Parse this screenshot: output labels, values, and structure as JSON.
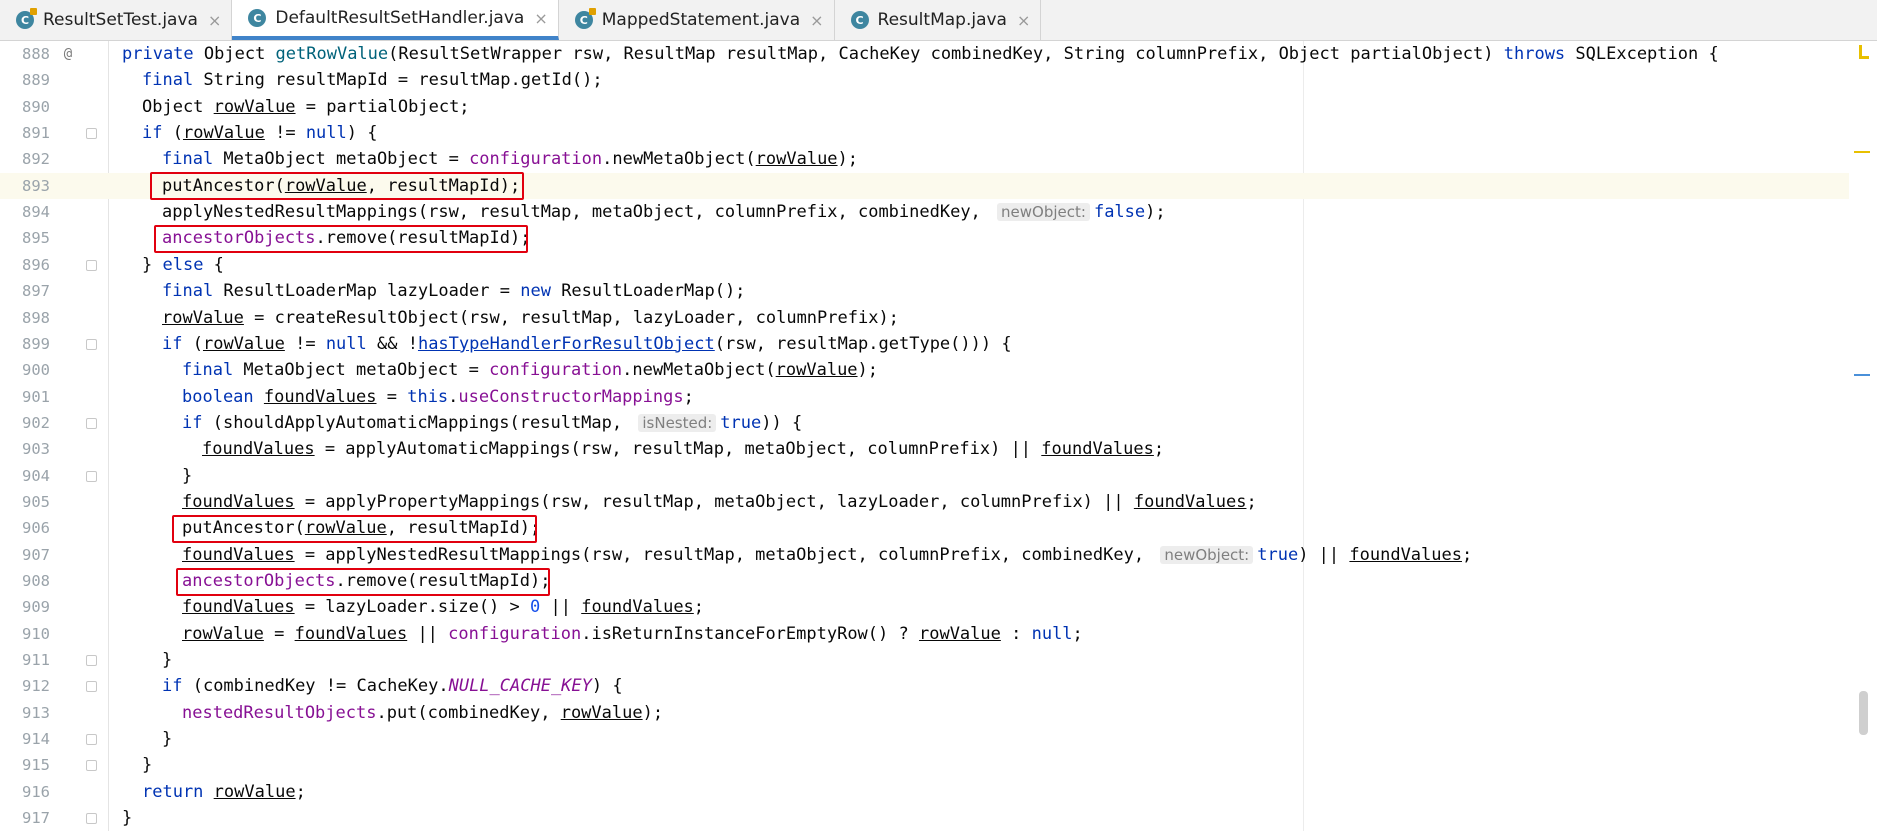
{
  "tabs": [
    {
      "label": "ResultSetTest.java",
      "icon": "java-class-icon",
      "active": false,
      "modified": true
    },
    {
      "label": "DefaultResultSetHandler.java",
      "icon": "java-class-icon",
      "active": true,
      "modified": false
    },
    {
      "label": "MappedStatement.java",
      "icon": "java-class-icon",
      "active": false,
      "modified": true
    },
    {
      "label": "ResultMap.java",
      "icon": "java-class-icon",
      "active": false,
      "modified": false
    }
  ],
  "editor": {
    "current_line": "893",
    "highlighted_lines": [
      "893",
      "895",
      "906",
      "908"
    ],
    "line_numbers": [
      "888",
      "889",
      "890",
      "891",
      "892",
      "893",
      "894",
      "895",
      "896",
      "897",
      "898",
      "899",
      "900",
      "901",
      "902",
      "903",
      "904",
      "905",
      "906",
      "907",
      "908",
      "909",
      "910",
      "911",
      "912",
      "913",
      "914",
      "915",
      "916",
      "917"
    ],
    "lines": [
      "private Object getRowValue(ResultSetWrapper rsw, ResultMap resultMap, CacheKey combinedKey, String columnPrefix, Object partialObject) throws SQLException {",
      "  final String resultMapId = resultMap.getId();",
      "  Object rowValue = partialObject;",
      "  if (rowValue != null) {",
      "    final MetaObject metaObject = configuration.newMetaObject(rowValue);",
      "    putAncestor(rowValue, resultMapId);",
      "    applyNestedResultMappings(rsw, resultMap, metaObject, columnPrefix, combinedKey, newObject: false);",
      "    ancestorObjects.remove(resultMapId);",
      "  } else {",
      "    final ResultLoaderMap lazyLoader = new ResultLoaderMap();",
      "    rowValue = createResultObject(rsw, resultMap, lazyLoader, columnPrefix);",
      "    if (rowValue != null && !hasTypeHandlerForResultObject(rsw, resultMap.getType())) {",
      "      final MetaObject metaObject = configuration.newMetaObject(rowValue);",
      "      boolean foundValues = this.useConstructorMappings;",
      "      if (shouldApplyAutomaticMappings(resultMap, isNested: true)) {",
      "        foundValues = applyAutomaticMappings(rsw, resultMap, metaObject, columnPrefix) || foundValues;",
      "      }",
      "      foundValues = applyPropertyMappings(rsw, resultMap, metaObject, lazyLoader, columnPrefix) || foundValues;",
      "      putAncestor(rowValue, resultMapId);",
      "      foundValues = applyNestedResultMappings(rsw, resultMap, metaObject, columnPrefix, combinedKey, newObject: true) || foundValues;",
      "      ancestorObjects.remove(resultMapId);",
      "      foundValues = lazyLoader.size() > 0 || foundValues;",
      "      rowValue = foundValues || configuration.isReturnInstanceForEmptyRow() ? rowValue : null;",
      "    }",
      "    if (combinedKey != CacheKey.NULL_CACHE_KEY) {",
      "      nestedResultObjects.put(combinedKey, rowValue);",
      "    }",
      "  }",
      "  return rowValue;",
      "}"
    ]
  },
  "colors": {
    "keyword": "#0033b3",
    "field": "#871094",
    "method_decl": "#00627a",
    "number": "#1750eb",
    "highlight_box": "#e1000f",
    "current_line_bg": "#fcfaed",
    "active_tab_underline": "#4083c9",
    "warning_stripe": "#e8c000",
    "info_stripe": "#4a90d9"
  }
}
